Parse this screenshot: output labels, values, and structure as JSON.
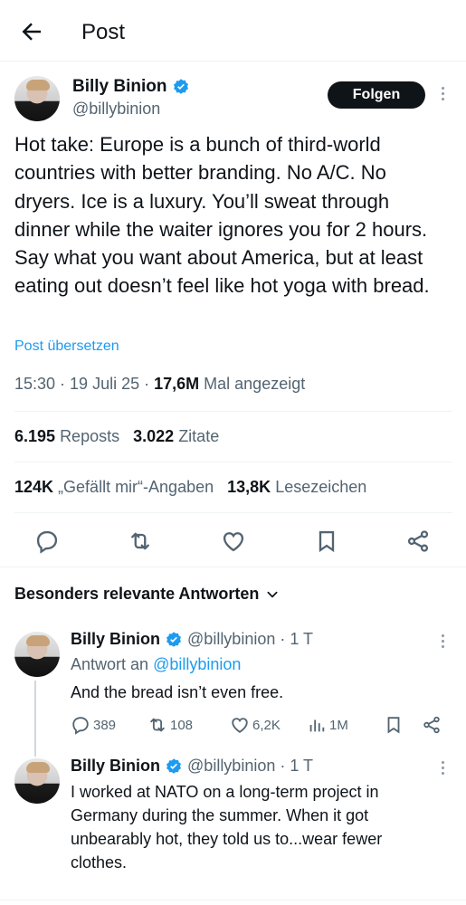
{
  "header": {
    "title": "Post"
  },
  "post": {
    "author_name": "Billy Binion",
    "author_handle": "@billybinion",
    "follow_label": "Folgen",
    "text": "Hot take: Europe is a bunch of third-world countries with better branding. No A/C. No dryers. Ice is a luxury. You’ll sweat through dinner while the waiter ignores you for 2 hours. Say what you want about America, but at least eating out doesn’t feel like hot yoga with bread.",
    "translate_label": "Post übersetzen",
    "time": "15:30",
    "date": "19 Juli 25",
    "views_count": "17,6M",
    "views_label": "Mal angezeigt",
    "reposts_count": "6.195",
    "reposts_label": "Reposts",
    "quotes_count": "3.022",
    "quotes_label": "Zitate",
    "likes_count": "124K",
    "likes_label": "„Gefällt mir“-Angaben",
    "bookmarks_count": "13,8K",
    "bookmarks_label": "Lesezeichen"
  },
  "replies_header": {
    "label": "Besonders relevante Antworten"
  },
  "replies": [
    {
      "author_name": "Billy Binion",
      "author_handle": "@billybinion",
      "age": "· 1 T",
      "reply_to_prefix": "Antwort an",
      "reply_to_handle": "@billybinion",
      "text": "And the bread isn’t even free.",
      "reply_count": "389",
      "repost_count": "108",
      "like_count": "6,2K",
      "view_count": "1M"
    },
    {
      "author_name": "Billy Binion",
      "author_handle": "@billybinion",
      "age": "· 1 T",
      "text": "I worked at NATO on a long-term project in Germany during the summer. When it got unbearably hot, they told us to...wear fewer clothes."
    }
  ],
  "colors": {
    "accent": "#1d9bf0",
    "text": "#0f1419",
    "muted": "#536471"
  },
  "icons": [
    "back-arrow-icon",
    "verified-badge-icon",
    "more-options-icon",
    "reply-icon",
    "repost-icon",
    "like-icon",
    "bookmark-icon",
    "share-icon",
    "views-icon",
    "chevron-down-icon"
  ]
}
